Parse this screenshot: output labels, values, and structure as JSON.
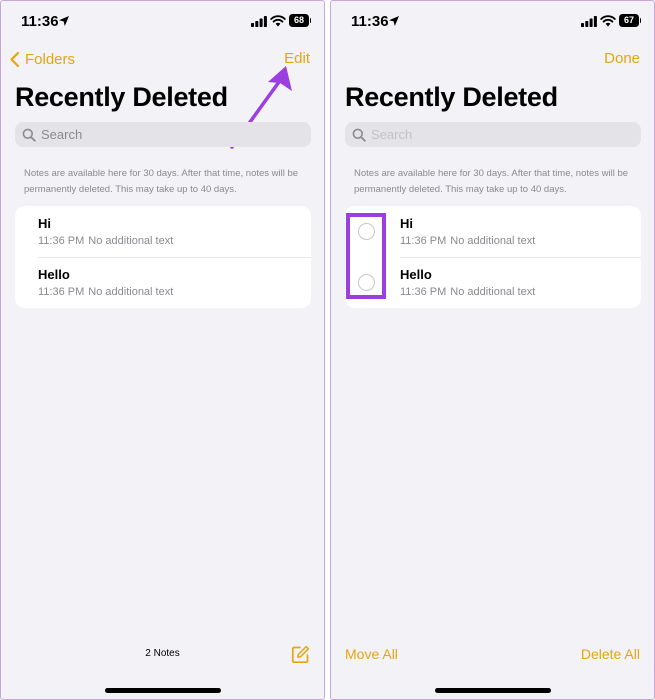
{
  "colors": {
    "accent": "#e5a60f",
    "annotation": "#9b3fe0",
    "background": "#f2f2f7"
  },
  "left": {
    "status": {
      "time": "11:36",
      "battery": "68"
    },
    "nav": {
      "back_label": "Folders",
      "right_label": "Edit"
    },
    "title": "Recently Deleted",
    "search": {
      "placeholder": "Search"
    },
    "info": "Notes are available here for 30 days. After that time, notes will be permanently deleted. This may take up to 40 days.",
    "notes": [
      {
        "title": "Hi",
        "time": "11:36 PM",
        "subtitle": "No additional text"
      },
      {
        "title": "Hello",
        "time": "11:36 PM",
        "subtitle": "No additional text"
      }
    ],
    "footer": {
      "count": "2 Notes"
    }
  },
  "right": {
    "status": {
      "time": "11:36",
      "battery": "67"
    },
    "nav": {
      "right_label": "Done"
    },
    "title": "Recently Deleted",
    "search": {
      "placeholder": "Search"
    },
    "info": "Notes are available here for 30 days. After that time, notes will be permanently deleted. This may take up to 40 days.",
    "notes": [
      {
        "title": "Hi",
        "time": "11:36 PM",
        "subtitle": "No additional text"
      },
      {
        "title": "Hello",
        "time": "11:36 PM",
        "subtitle": "No additional text"
      }
    ],
    "footer": {
      "move_all": "Move All",
      "delete_all": "Delete All"
    }
  },
  "icons": [
    "location-arrow-icon",
    "cellular-signal-icon",
    "wifi-icon",
    "battery-icon",
    "chevron-left-icon",
    "search-icon",
    "compose-icon",
    "annotation-arrow-icon",
    "selection-circle-icon"
  ]
}
